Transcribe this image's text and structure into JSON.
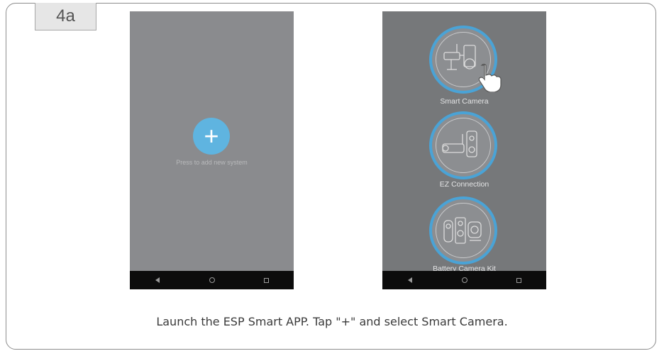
{
  "step": {
    "label": "4a"
  },
  "left_phone": {
    "add_button_symbol": "+",
    "add_text": "Press to add new system",
    "nav": {
      "back_icon": "triangle-back-icon",
      "home_icon": "circle-home-icon",
      "recent_icon": "square-recent-icon"
    }
  },
  "right_phone": {
    "options": [
      {
        "label": "Smart Camera",
        "icon": "smart-camera-icon"
      },
      {
        "label": "EZ Connection",
        "icon": "ez-connection-icon"
      },
      {
        "label": "Battery Camera Kit",
        "icon": "battery-camera-kit-icon"
      }
    ],
    "pointer_icon": "hand-pointer-icon"
  },
  "caption": "Launch the ESP Smart APP. Tap \"+\" and select Smart Camera.",
  "colors": {
    "accent": "#4aa3d6",
    "add_button": "#5fb4e0",
    "phone_bg": "#8a8b8e"
  }
}
